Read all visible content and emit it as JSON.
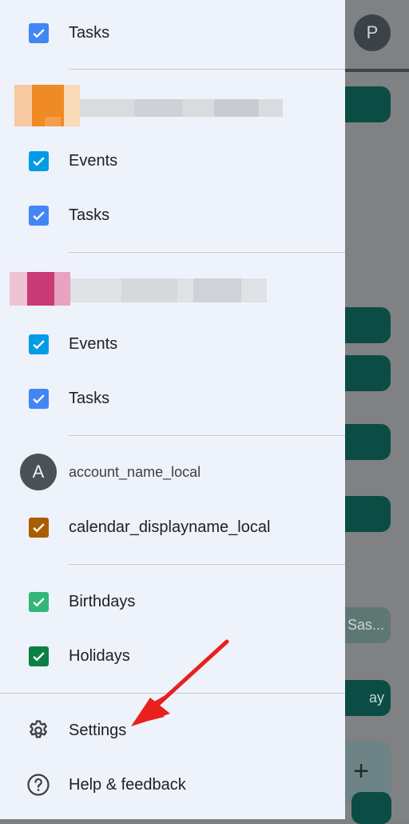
{
  "background": {
    "avatar_letter": "P",
    "pill_texts": [
      "Sas...",
      "ay"
    ],
    "fab_label": "+"
  },
  "drawer": {
    "groups": [
      {
        "items": [
          {
            "label": "Tasks",
            "color": "#4285f4"
          }
        ]
      },
      {
        "items": [
          {
            "label": "Events",
            "color": "#039be5"
          },
          {
            "label": "Tasks",
            "color": "#4285f4"
          }
        ]
      },
      {
        "items": [
          {
            "label": "Events",
            "color": "#039be5"
          },
          {
            "label": "Tasks",
            "color": "#4285f4"
          }
        ]
      }
    ],
    "local_account": {
      "avatar_letter": "A",
      "name": "account_name_local",
      "calendar": {
        "label": "calendar_displayname_local",
        "color": "#a95d00"
      }
    },
    "other_calendars": [
      {
        "label": "Birthdays",
        "color": "#33b679"
      },
      {
        "label": "Holidays",
        "color": "#0b8043"
      }
    ],
    "menu": {
      "settings_label": "Settings",
      "help_label": "Help & feedback"
    }
  }
}
